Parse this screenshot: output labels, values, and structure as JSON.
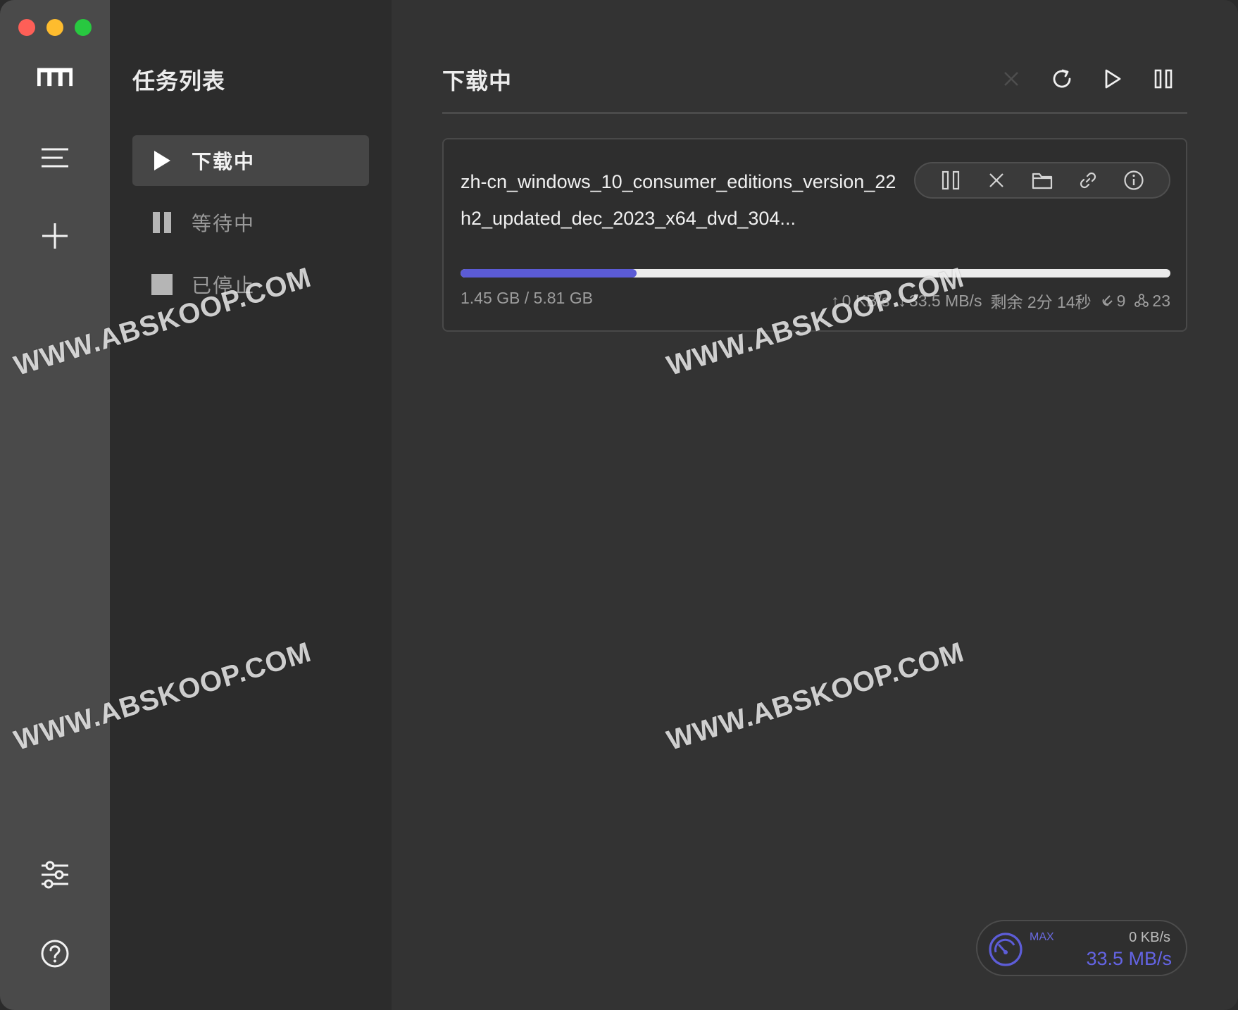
{
  "app": {
    "traffic_lights": [
      "close",
      "minimize",
      "zoom"
    ],
    "colors": {
      "accent": "#5b5bd6",
      "rail": "#4a4a4a",
      "panel": "#2c2c2c",
      "main": "#333333"
    }
  },
  "rail": {
    "logo_icon": "motrix-logo-icon",
    "menu_icon": "menu-icon",
    "add_icon": "plus-icon",
    "settings_icon": "sliders-icon",
    "help_icon": "help-circle-icon"
  },
  "tasklist": {
    "title": "任务列表",
    "items": [
      {
        "label": "下载中",
        "icon": "play-icon",
        "active": true
      },
      {
        "label": "等待中",
        "icon": "pause-icon",
        "active": false
      },
      {
        "label": "已停止",
        "icon": "stop-icon",
        "active": false
      }
    ]
  },
  "main": {
    "title": "下载中",
    "toolbar": {
      "icons": [
        "close-icon",
        "refresh-icon",
        "play-icon",
        "pause-icon"
      ]
    }
  },
  "task": {
    "name": "zh-cn_windows_10_consumer_editions_version_22h2_updated_dec_2023_x64_dvd_304...",
    "actions": [
      "pause-icon",
      "close-icon",
      "folder-icon",
      "link-icon",
      "info-icon"
    ],
    "progress_fraction": 0.248,
    "size_text": "1.45 GB / 5.81 GB",
    "upload_speed": "0 KB/s",
    "download_speed": "33.5 MB/s",
    "remaining": "剩余 2分 14秒",
    "connections": "9",
    "peers": "23"
  },
  "speedometer": {
    "mode": "MAX",
    "upload": "0 KB/s",
    "download": "33.5 MB/s"
  },
  "watermark": {
    "text": "WWW.ABSKOOP.COM"
  }
}
